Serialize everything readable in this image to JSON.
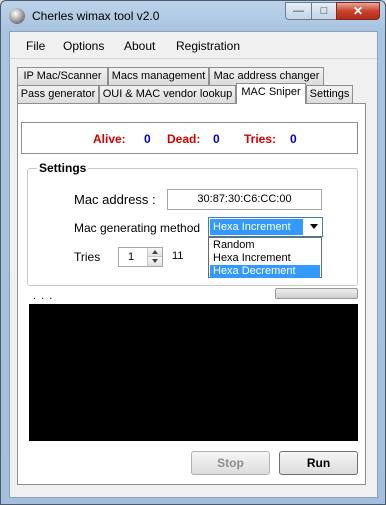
{
  "window": {
    "title": "Cherles wimax tool v2.0",
    "buttons": {
      "minimize": "—",
      "maximize": "□",
      "close": "✕"
    }
  },
  "menu": [
    "File",
    "Options",
    "About",
    "Registration"
  ],
  "tabs": {
    "row1": [
      "IP Mac/Scanner",
      "Macs management",
      "Mac address changer"
    ],
    "row2": [
      "Pass generator",
      "OUI & MAC vendor lookup",
      "MAC Sniper",
      "Settings"
    ],
    "active": "MAC Sniper"
  },
  "stats": {
    "alive_label": "Alive:",
    "alive_value": "0",
    "dead_label": "Dead:",
    "dead_value": "0",
    "tries_label": "Tries:",
    "tries_value": "0"
  },
  "settings": {
    "title": "Settings",
    "mac_label": "Mac address :",
    "mac_value": "30:87:30:C6:CC:00",
    "method_label": "Mac generating method",
    "method_selected": "Hexa Increment",
    "method_options": [
      "Random",
      "Hexa Increment",
      "Hexa Decrement"
    ],
    "method_highlighted": "Hexa Decrement",
    "tries_label": "Tries",
    "tries_value": "1",
    "tries_extra": "11"
  },
  "progress_text": ". . .",
  "buttons": {
    "stop": "Stop",
    "run": "Run"
  }
}
